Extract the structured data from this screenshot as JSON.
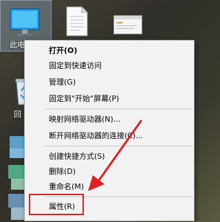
{
  "desktop": {
    "this_pc_label": "此电",
    "recycle_label": "回"
  },
  "context_menu": {
    "items": [
      {
        "label": "打开(O)"
      },
      {
        "label": "固定到快速访问"
      },
      {
        "label": "管理(G)"
      },
      {
        "label": "固定到\"开始\"屏幕(P)"
      },
      {
        "label": "映射网络驱动器(N)..."
      },
      {
        "label": "断开网络驱动器的连接(C)..."
      },
      {
        "label": "创建快捷方式(S)"
      },
      {
        "label": "删除(D)"
      },
      {
        "label": "重命名(M)"
      },
      {
        "label": "属性(R)"
      }
    ]
  },
  "colors": {
    "highlight_box": "#e02020",
    "arrow": "#e02020",
    "menu_background": "#f2f2f2"
  }
}
